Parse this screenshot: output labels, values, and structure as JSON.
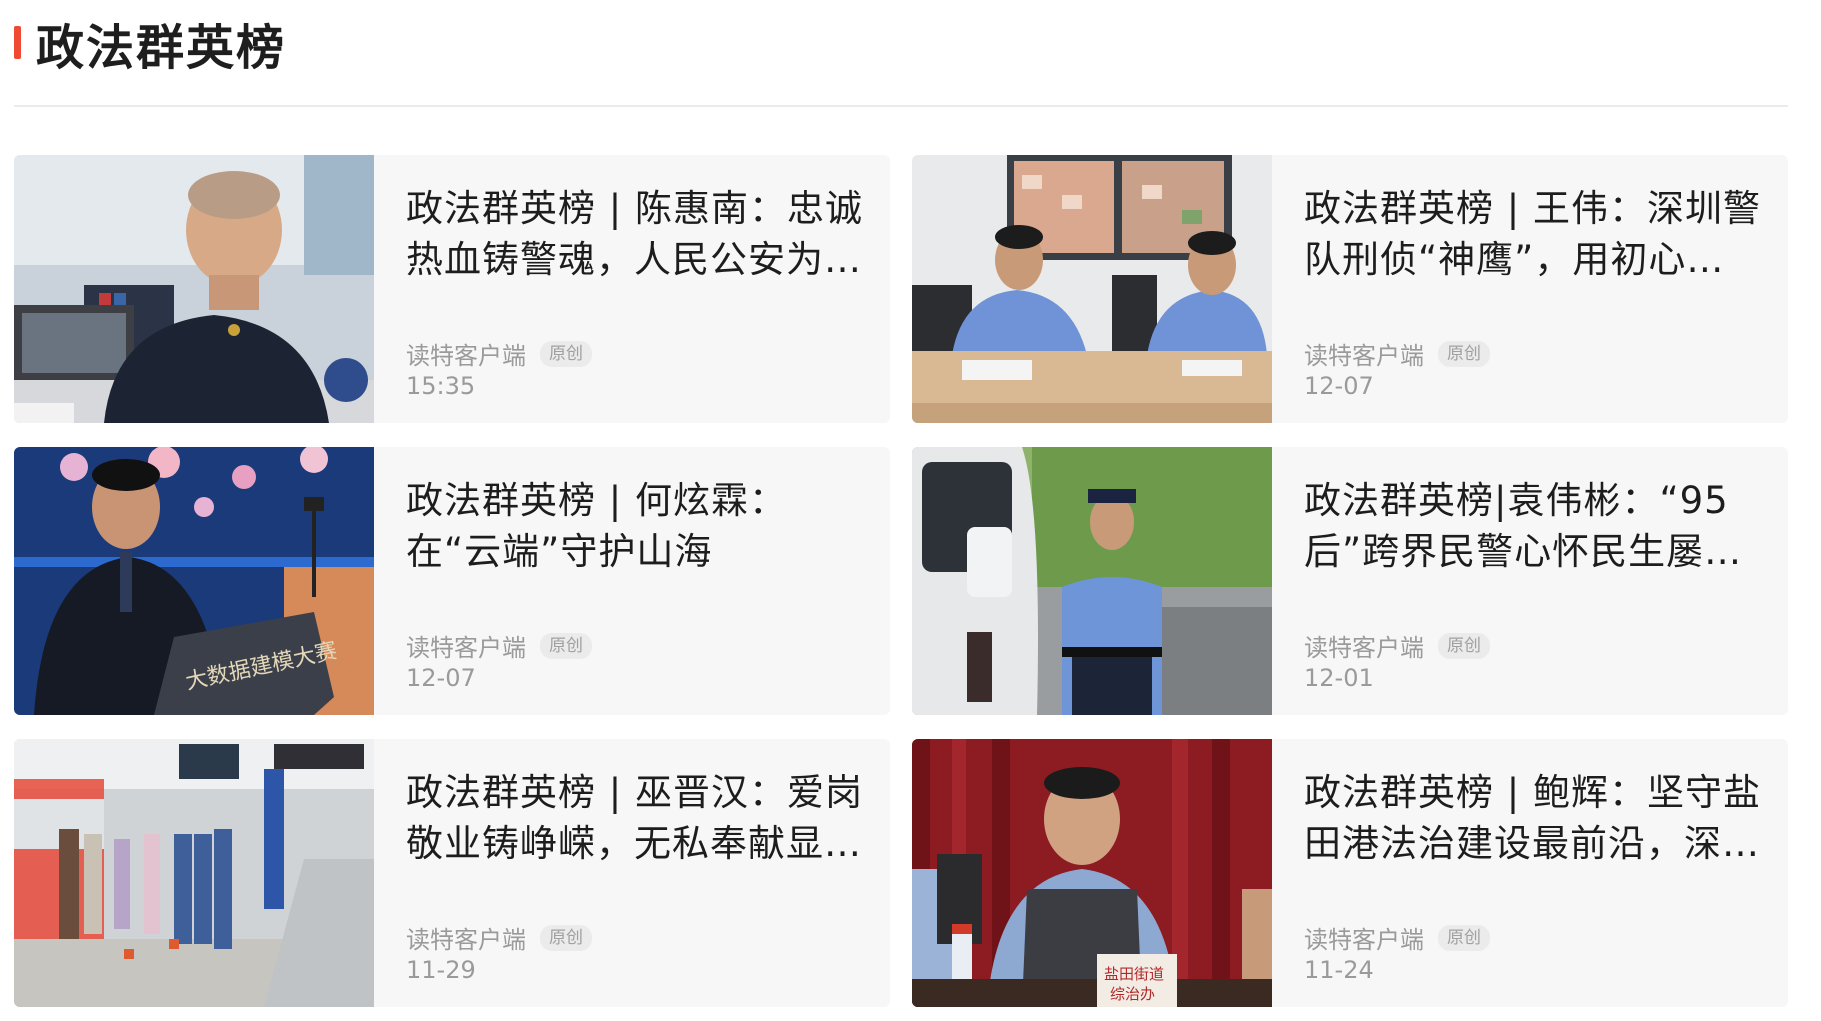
{
  "section": {
    "title": "政法群英榜",
    "accent_color": "#f04a32"
  },
  "articles": [
    {
      "title": "政法群英榜 | 陈惠南：忠诚热血铸警魂，人民公安为…",
      "source": "读特客户端",
      "badge": "原创",
      "time": "15:35",
      "image": "officer-at-desk-photo"
    },
    {
      "title": "政法群英榜 | 王伟：深圳警队刑侦“神鹰”，用初心…",
      "source": "读特客户端",
      "badge": "原创",
      "time": "12-07",
      "image": "two-officers-writing-photo"
    },
    {
      "title": "政法群英榜 | 何炫霖：在“云端”守护山海",
      "source": "读特客户端",
      "badge": "原创",
      "time": "12-07",
      "image": "officer-at-podium-photo"
    },
    {
      "title": "政法群英榜|袁伟彬：“95后”跨界民警心怀民生屡…",
      "source": "读特客户端",
      "badge": "原创",
      "time": "12-01",
      "image": "officer-by-van-photo"
    },
    {
      "title": "政法群英榜 | 巫晋汉：爱岗敬业铸峥嵘，无私奉献显…",
      "source": "读特客户端",
      "badge": "原创",
      "time": "11-29",
      "image": "officers-on-metro-platform-photo"
    },
    {
      "title": "政法群英榜 | 鲍辉：坚守盐田港法治建设最前沿，深…",
      "source": "读特客户端",
      "badge": "原创",
      "time": "11-24",
      "image": "speaker-at-meeting-photo"
    }
  ]
}
